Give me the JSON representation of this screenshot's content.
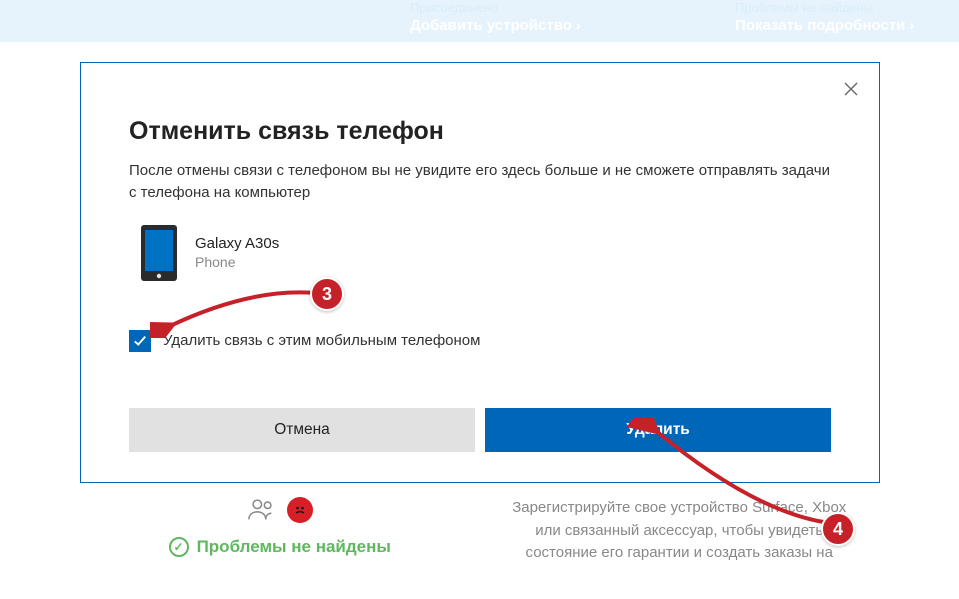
{
  "banner": {
    "link1_sub": "Присоединено",
    "link1": "Добавить устройство",
    "link2_sub": "Проблемы не найдены",
    "link2": "Показать подробности"
  },
  "modal": {
    "title": "Отменить связь телефон",
    "description": "После отмены связи с телефоном вы не увидите его здесь больше и не сможете отправлять задачи с телефона на компьютер",
    "device": {
      "name": "Galaxy A30s",
      "type": "Phone"
    },
    "checkbox_label": "Удалить связь с этим мобильным телефоном",
    "checkbox_checked": true,
    "cancel_label": "Отмена",
    "delete_label": "Удалить"
  },
  "background": {
    "status_text": "Проблемы не найдены",
    "card_right": "Зарегистрируйте свое устройство Surface, Xbox или связанный аксессуар, чтобы увидеть состояние его гарантии и создать заказы на"
  },
  "annotations": {
    "step3": "3",
    "step4": "4"
  }
}
